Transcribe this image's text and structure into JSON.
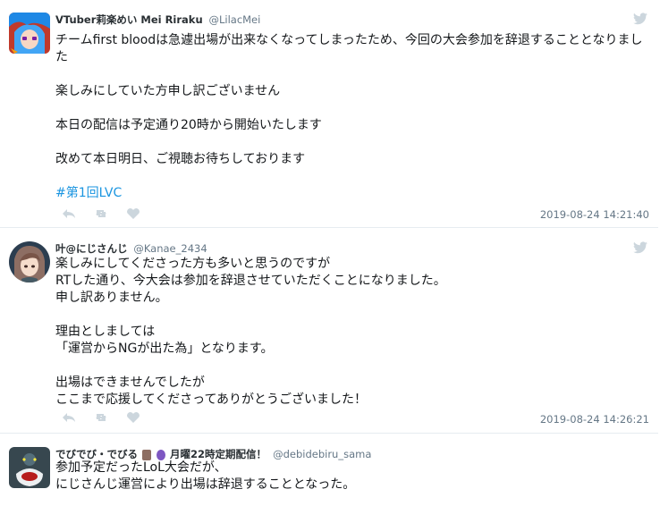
{
  "tweets": [
    {
      "name": "VTuber莉楽めい Mei Riraku",
      "handle": "@LilacMei",
      "body": "チームfirst bloodは急遽出場が出来なくなってしまったため、今回の大会参加を辞退することとなりました\n\n楽しみにしていた方申し訳ございません\n\n本日の配信は予定通り20時から開始いたします\n\n改めて本日明日、ご視聴お待ちしております",
      "hashtag": "#第1回LVC",
      "timestamp": "2019-08-24 14:21:40",
      "avatar_icon": "avatar-blue-hair-icon"
    },
    {
      "name": "叶@にじさんじ",
      "handle": "@Kanae_2434",
      "body": "楽しみにしてくださった方も多いと思うのですが\nRTした通り、今大会は参加を辞退させていただくことになりました。\n申し訳ありません。\n\n理由としましては\n「運営からNGが出た為」となります。\n\n出場はできませんでしたが\nここまで応援してくださってありがとうございました！",
      "timestamp": "2019-08-24 14:26:21",
      "avatar_icon": "avatar-brown-hair-icon"
    },
    {
      "name_prefix": "でびでび・でびる",
      "name_suffix": "月曜22時定期配信！",
      "handle": "@debidebiru_sama",
      "body": "参加予定だったLoL大会だが、\nにじさんじ運営により出場は辞退することとなった。",
      "avatar_icon": "avatar-dark-creature-icon"
    }
  ],
  "colors": {
    "link": "#1b95e0",
    "muted": "#657786",
    "divider": "#e6ecf0",
    "text": "#14171a"
  },
  "icons": [
    "twitter-bird-icon",
    "reply-icon",
    "retweet-icon",
    "like-icon"
  ]
}
